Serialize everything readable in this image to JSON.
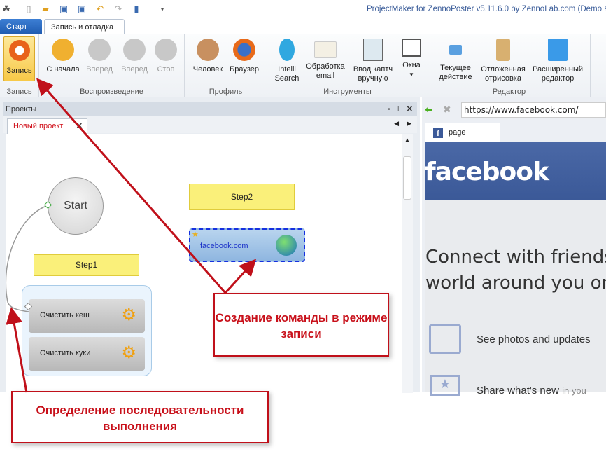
{
  "window": {
    "title": "ProjectMaker for ZennoPoster v5.11.6.0 by ZennoLab.com (Demo вер"
  },
  "ribbon_tabs": [
    "Старт",
    "Запись и отладка"
  ],
  "ribbon": {
    "groups": [
      "Запись",
      "Воспроизведение",
      "Профиль",
      "Инструменты",
      "Редактор"
    ],
    "record": "Запись",
    "playback": [
      "С начала",
      "Вперед",
      "Вперед",
      "Стоп"
    ],
    "profile": [
      "Человек",
      "Браузер"
    ],
    "tools": [
      "Intelli Search",
      "Обработка email",
      "Ввод каптч вручную",
      "Окна"
    ],
    "editor": [
      "Текущее действие",
      "Отложенная отрисовка",
      "Расширенный редактор"
    ]
  },
  "projects": {
    "title": "Проекты",
    "tab": "Новый проект",
    "nodes": {
      "start": "Start",
      "step1": "Step1",
      "step2": "Step2",
      "fb": "facebook.com",
      "clear_cache": "Очистить кеш",
      "clear_cookies": "Очистить куки"
    }
  },
  "browser": {
    "url": "https://www.facebook.com/",
    "tab": "page",
    "logo": "facebook",
    "headline1": "Connect with friends",
    "headline2": "world around you on",
    "feature1": "See photos and updates",
    "feature2": "Share what's new",
    "feature2b": "in you"
  },
  "callouts": {
    "record_mode": "Создание команды в режиме записи",
    "sequence": "Определение последовательности выполнения"
  },
  "colors": {
    "accent": "#c0101a",
    "fb": "#3b5998"
  }
}
